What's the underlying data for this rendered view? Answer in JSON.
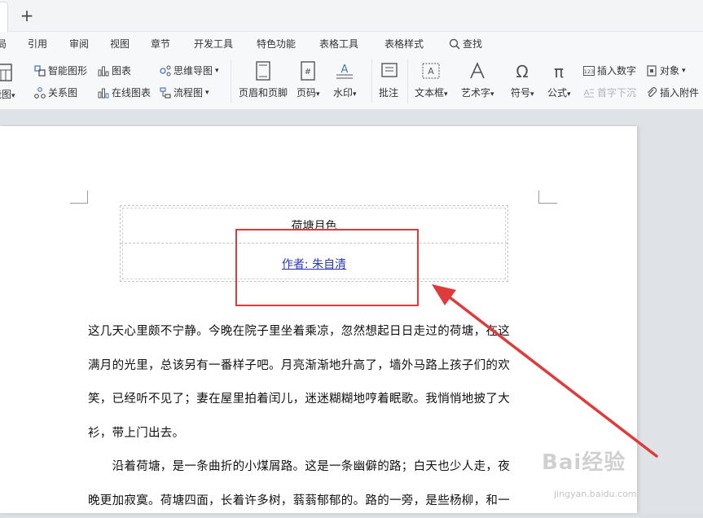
{
  "tabbar": {
    "new_tab": "+"
  },
  "menu": [
    "局",
    "引用",
    "审阅",
    "视图",
    "章节",
    "开发工具",
    "特色功能",
    "表格工具",
    "表格样式",
    "查找"
  ],
  "ribbon": {
    "partial_big": "能图",
    "smart_shape": "智能图形",
    "chart": "图表",
    "mindmap": "思维导图",
    "relation": "关系图",
    "online_chart": "在线图表",
    "flowchart": "流程图",
    "header_footer": "页眉和页脚",
    "page_num": "页码",
    "watermark": "水印",
    "comment": "批注",
    "textbox": "文本框",
    "art_text": "艺术字",
    "symbol": "符号",
    "formula": "公式",
    "insert_number": "插入数字",
    "object": "对象",
    "drop_cap": "首字下沉",
    "attachment": "插入附件"
  },
  "document": {
    "title": "荷塘月色",
    "author": "作者: 朱自清",
    "paragraph1_lines": [
      "这几天心里颇不宁静。今晚在院子里坐着乘凉，忽然想起日日走过的荷塘，在这",
      "满月的光里，总该另有一番样子吧。月亮渐渐地升高了，墙外马路上孩子们的欢",
      "笑，已经听不见了；妻在屋里拍着闰儿，迷迷糊糊地哼着眠歌。我悄悄地披了大",
      "衫，带上门出去。"
    ],
    "paragraph2_lines": [
      "　　沿着荷塘，是一条曲折的小煤屑路。这是一条幽僻的路；白天也少人走，夜",
      "晚更加寂寞。荷塘四面，长着许多树，蓊蓊郁郁的。路的一旁，是些杨柳，和一"
    ]
  },
  "annotation_color": "#e03b3b",
  "watermark": {
    "text": "Bai经验",
    "sub": "jingyan.baidu.com"
  }
}
